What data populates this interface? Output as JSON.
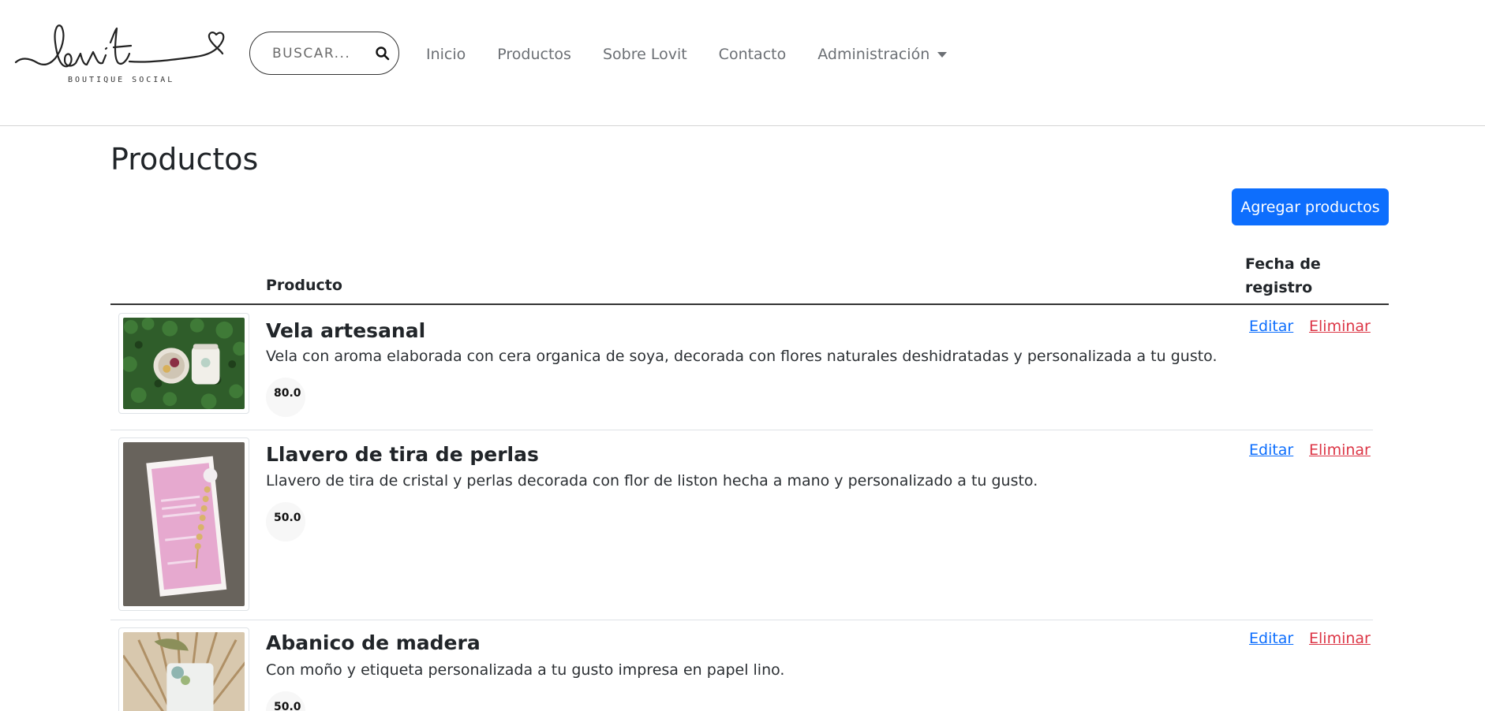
{
  "header": {
    "logo_text": "lovit",
    "logo_subtitle": "BOUTIQUE SOCIAL",
    "search": {
      "placeholder": "BUSCAR..."
    },
    "nav": [
      {
        "label": "Inicio"
      },
      {
        "label": "Productos"
      },
      {
        "label": "Sobre Lovit"
      },
      {
        "label": "Contacto"
      },
      {
        "label": "Administración"
      }
    ]
  },
  "main": {
    "title": "Productos",
    "add_button": "Agregar productos",
    "table": {
      "col_product": "Producto",
      "col_date": "Fecha de registro"
    },
    "products": [
      {
        "name": "Vela artesanal",
        "description": "Vela con aroma elaborada con cera organica de soya, decorada con flores naturales deshidratadas y personalizada a tu gusto.",
        "price": "80.0",
        "edit": "Editar",
        "delete": "Eliminar"
      },
      {
        "name": "Llavero de tira de perlas",
        "description": "Llavero de tira de cristal y perlas decorada con flor de liston hecha a mano y personalizado a tu gusto.",
        "price": "50.0",
        "edit": "Editar",
        "delete": "Eliminar"
      },
      {
        "name": "Abanico de madera",
        "description": "Con moño y etiqueta personalizada a tu gusto impresa en papel lino.",
        "price": "50.0",
        "edit": "Editar",
        "delete": "Eliminar"
      }
    ]
  },
  "colors": {
    "primary": "#0d6efd",
    "danger": "#dc3545",
    "nav_text": "#6b6f74"
  }
}
